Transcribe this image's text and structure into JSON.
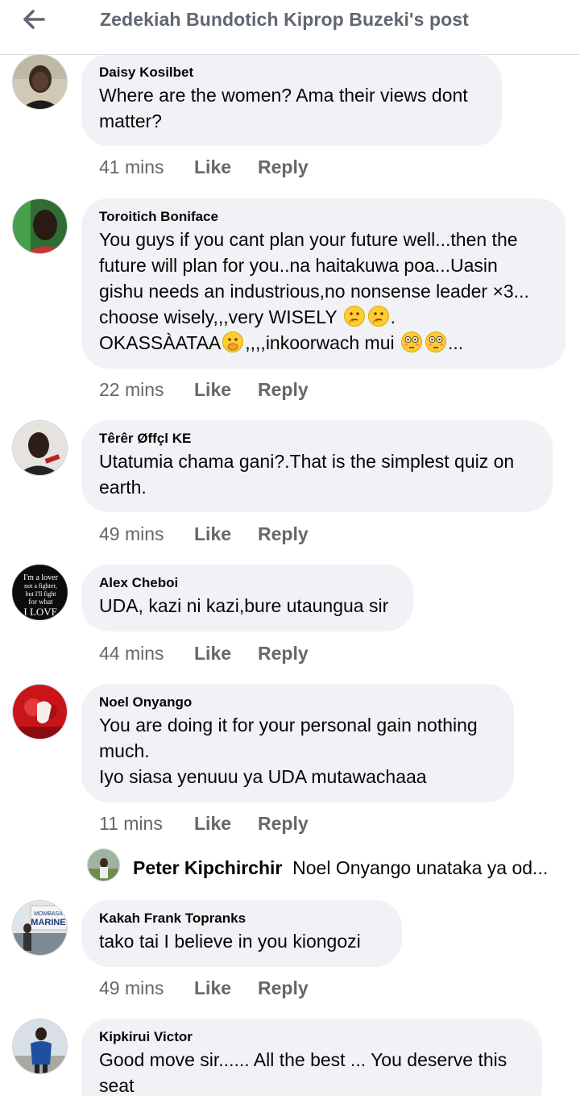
{
  "header": {
    "title": "Zedekiah Bundotich Kiprop Buzeki's post",
    "back_icon": "back-arrow-icon"
  },
  "actions": {
    "like": "Like",
    "reply": "Reply"
  },
  "comments": [
    {
      "name": "Daisy Kosilbet",
      "lines": [
        "Where are the women? Ama their views dont",
        "matter?"
      ],
      "time": "41 mins"
    },
    {
      "name": "Toroitich Boniface",
      "lines": [
        "You guys if you cant plan your future well...then the",
        "future will plan for you..na haitakuwa poa...Uasin",
        "gishu needs an industrious,no nonsense leader  ×3...",
        "choose wisely,,,very WISELY",
        "OKASSÀATAA",
        ",,,,inkoorwach mui",
        "..."
      ],
      "time": "22 mins"
    },
    {
      "name": "Têrêr Øffçl KE",
      "lines": [
        "Utatumia chama gani?.That is the simplest quiz on",
        "earth."
      ],
      "time": "49 mins"
    },
    {
      "name": "Alex Cheboi",
      "lines": [
        "UDA, kazi ni kazi,bure utaungua sir"
      ],
      "time": "44 mins",
      "avatar_text": [
        "I'm a lover",
        "not a fighter,",
        "but I'll fight",
        "for what",
        "I LOVE"
      ]
    },
    {
      "name": "Noel Onyango",
      "lines": [
        "You are doing it for your personal gain nothing",
        "much.",
        "Iyo siasa yenuuu ya UDA mutawachaaa"
      ],
      "time": "11 mins"
    },
    {
      "name": "Kakah Frank Topranks",
      "lines": [
        "tako tai I believe in you  kiongozi"
      ],
      "time": "49 mins",
      "avatar_text": [
        "MOMBASA",
        "MARINE"
      ]
    },
    {
      "name": "Kipkirui Victor",
      "lines": [
        "Good move sir...... All the best ... You deserve this",
        "seat"
      ]
    }
  ],
  "reply_preview": {
    "name": "Peter Kipchirchir",
    "text": "Noel Onyango unataka ya od..."
  },
  "colors": {
    "bubble": "#f0f2f5",
    "meta": "#65676b",
    "header_text": "#606770"
  }
}
